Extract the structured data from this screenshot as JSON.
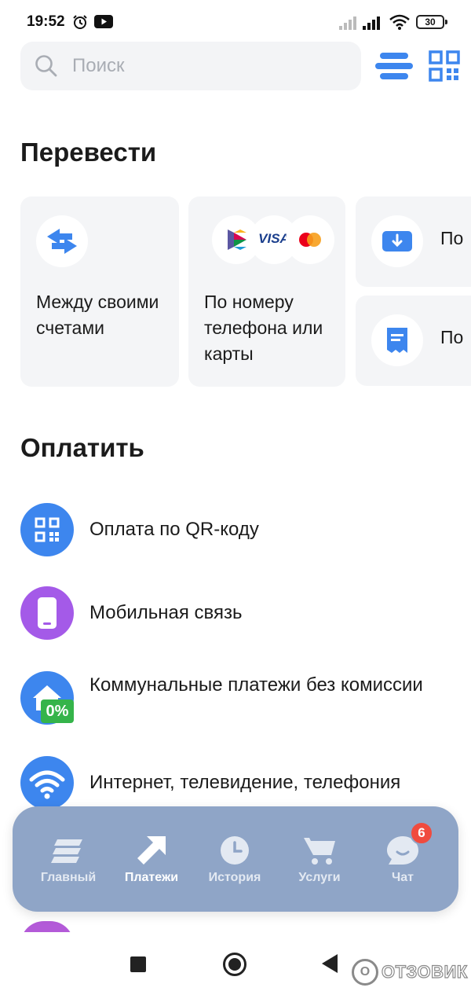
{
  "status_bar": {
    "time": "19:52",
    "battery": "30",
    "icons": [
      "alarm-icon",
      "youtube-icon",
      "signal-icon",
      "signal-icon",
      "wifi-icon",
      "battery-icon"
    ]
  },
  "search": {
    "placeholder": "Поиск"
  },
  "transfer": {
    "title": "Перевести",
    "cards": [
      {
        "label": "Между своими счетами",
        "icon": "swap-arrows-icon"
      },
      {
        "label": "По номеру телефона или карты",
        "icons": [
          "sbp-logo-icon",
          "visa-logo-icon",
          "mastercard-logo-icon"
        ],
        "visa_text": "VISA"
      },
      {
        "label": "По",
        "icon": "download-icon"
      },
      {
        "label": "По",
        "icon": "receipt-icon"
      }
    ]
  },
  "pay": {
    "title": "Оплатить",
    "items": [
      {
        "label": "Оплата по QR-коду",
        "icon": "qr-code-icon"
      },
      {
        "label": "Мобильная связь",
        "icon": "phone-icon"
      },
      {
        "label": "Коммунальные платежи без комиссии",
        "icon": "house-icon",
        "badge": "0%"
      },
      {
        "label": "Интернет, телевидение, телефония",
        "icon": "wifi-icon"
      }
    ]
  },
  "bottom_nav": {
    "items": [
      {
        "label": "Главный",
        "icon": "home-stack-icon",
        "active": false
      },
      {
        "label": "Платежи",
        "icon": "arrow-up-right-icon",
        "active": true
      },
      {
        "label": "История",
        "icon": "clock-icon",
        "active": false
      },
      {
        "label": "Услуги",
        "icon": "cart-icon",
        "active": false
      },
      {
        "label": "Чат",
        "icon": "chat-icon",
        "active": false,
        "badge": "6"
      }
    ]
  },
  "watermark": {
    "circle_text": "O",
    "text": "ОТЗОВИК"
  },
  "colors": {
    "accent": "#3d86ee",
    "purple": "#a45ae8",
    "nav_background": "#8fa5c7",
    "badge": "#f04b3e",
    "card_background": "#f4f5f7"
  }
}
